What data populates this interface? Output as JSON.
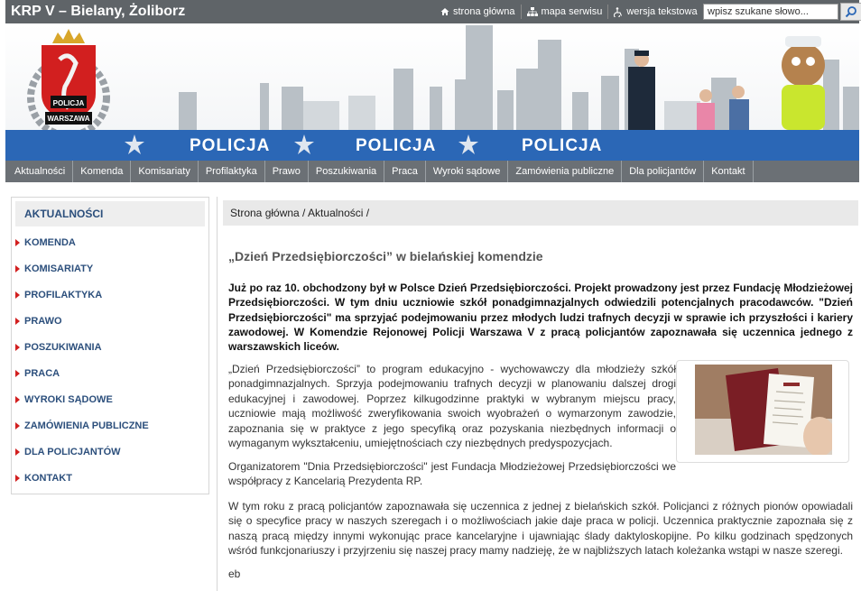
{
  "header": {
    "site_title": "KRP V – Bielany, Żoliborz",
    "links": [
      {
        "label": "strona główna",
        "icon": "home-icon"
      },
      {
        "label": "mapa serwisu",
        "icon": "sitemap-icon"
      },
      {
        "label": "wersja tekstowa",
        "icon": "accessibility-icon"
      }
    ],
    "search": {
      "value": "wpisz szukane słowo...",
      "button_icon": "search-icon"
    }
  },
  "banner": {
    "stripe_word": "POLICJA",
    "badge_top": "POLICJA",
    "badge_bottom": "WARSZAWA",
    "colors": {
      "stripe": "#2b67b6",
      "shield": "#d21f1f"
    }
  },
  "nav": {
    "items": [
      "Aktualności",
      "Komenda",
      "Komisariaty",
      "Profilaktyka",
      "Prawo",
      "Poszukiwania",
      "Praca",
      "Wyroki sądowe",
      "Zamówienia publiczne",
      "Dla policjantów",
      "Kontakt"
    ]
  },
  "sidebar": {
    "heading": "AKTUALNOŚCI",
    "items": [
      "KOMENDA",
      "KOMISARIATY",
      "PROFILAKTYKA",
      "PRAWO",
      "POSZUKIWANIA",
      "PRACA",
      "WYROKI SĄDOWE",
      "ZAMÓWIENIA PUBLICZNE",
      "DLA POLICJANTÓW",
      "KONTAKT"
    ]
  },
  "main": {
    "breadcrumb": "Strona główna / Aktualności /",
    "title": "„Dzień Przedsiębiorczości” w bielańskiej komendzie",
    "lead": "Już po raz 10. obchodzony był w Polsce Dzień Przedsiębiorczości. Projekt prowadzony jest przez Fundację Młodzieżowej Przedsiębiorczości. W tym dniu uczniowie szkół ponadgimnazjalnych odwiedzili potencjalnych pracodawców. \"Dzień Przedsiębiorczości\" ma sprzyjać podejmowaniu przez młodych ludzi trafnych decyzji w sprawie ich przyszłości i kariery zawodowej. W Komendzie Rejonowej Policji Warszawa V z pracą policjantów zapoznawała się uczennica jednego z warszawskich liceów.",
    "paragraph1": "„Dzień Przedsiębiorczości” to program edukacyjno - wychowawczy dla młodzieży szkół ponadgimnazjalnych. Sprzyja podejmowaniu trafnych decyzji w planowaniu dalszej drogi edukacyjnej i zawodowej. Poprzez kilkugodzinne praktyki w wybranym miejscu pracy, uczniowie mają możliwość zweryfikowania swoich wyobrażeń o wymarzonym zawodzie, zapoznania się w praktyce z jego specyfiką oraz pozyskania niezbędnych informacji o wymaganym wykształceniu, umiejętnościach czy niezbędnych predyspozycjach.",
    "paragraph2": "Organizatorem \"Dnia Przedsiębiorczości\" jest Fundacja Młodzieżowej Przedsiębiorczości we współpracy z Kancelarią Prezydenta RP.",
    "paragraph3": "W tym roku z pracą policjantów zapoznawała się uczennica z jednej z bielańskich szkół. Policjanci z różnych pionów opowiadali się o specyfice pracy w naszych szeregach i o możliwościach jakie daje praca w policji. Uczennica praktycznie zapoznała się z naszą pracą między innymi wykonując prace kancelaryjne i ujawniając ślady daktyloskopijne. Po kilku godzinach spędzonych wśród funkcjonariuszy i przyjrzeniu się naszej pracy mamy nadzieję, że w najbliższych latach koleżanka wstąpi w nasze szeregi.",
    "signature": "eb"
  }
}
